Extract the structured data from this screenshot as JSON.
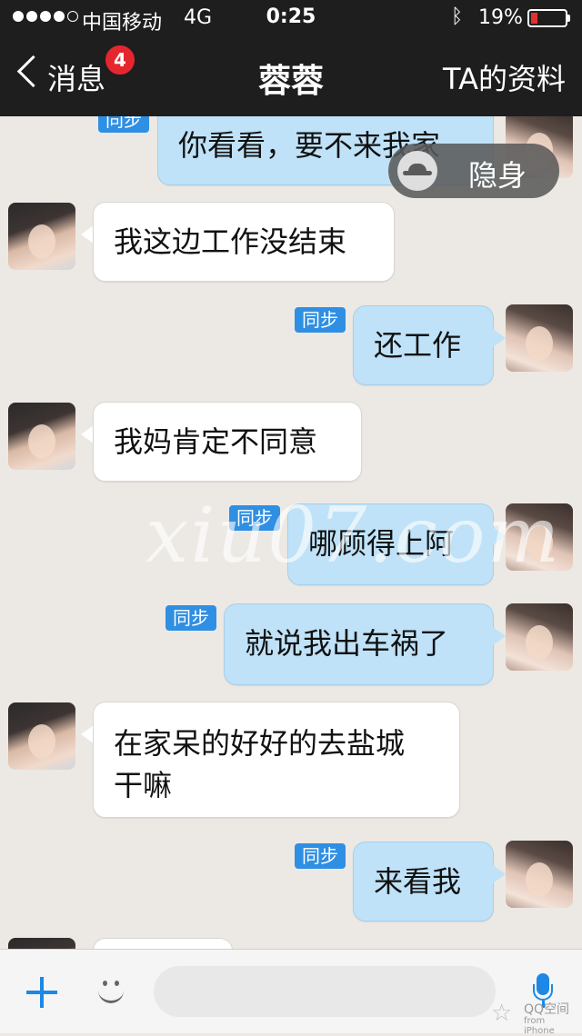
{
  "status_bar": {
    "carrier": "中国移动",
    "network": "4G",
    "time": "0:25",
    "battery_percent": "19%",
    "battery_level": 0.19,
    "battery_color": "#e53030",
    "signal_dots": 5,
    "signal_filled": 4,
    "bluetooth_icon": "bluetooth-icon"
  },
  "nav": {
    "back_label": "消息",
    "unread_badge": "4",
    "title": "蓉蓉",
    "right_label": "TA的资料"
  },
  "incognito_toast": {
    "icon": "incognito-hat-icon",
    "label": "隐身"
  },
  "sync_tag": "同步",
  "messages": [
    {
      "side": "out",
      "text": "你看看，要不来我家",
      "sync": true
    },
    {
      "side": "in",
      "text": "我这边工作没结束"
    },
    {
      "side": "out",
      "text": "还工作",
      "sync": true
    },
    {
      "side": "in",
      "text": "我妈肯定不同意"
    },
    {
      "side": "out",
      "text": "哪顾得上阿",
      "sync": true
    },
    {
      "side": "out",
      "text": "就说我出车祸了",
      "sync": true
    },
    {
      "side": "in",
      "text_line1": "在家呆的好好的去盐城",
      "text_line2": "干嘛"
    },
    {
      "side": "out",
      "text": "来看我",
      "sync": true
    },
    {
      "side": "in",
      "text": ""
    }
  ],
  "watermark": "xiu07.com",
  "input_bar": {
    "plus_icon": "plus-icon",
    "emoji_icon": "emoji-icon",
    "voice_icon": "microphone-icon"
  },
  "app_watermark": {
    "line1": "QQ空间",
    "line2": "from iPhone"
  },
  "colors": {
    "nav_bg": "#1e1e1e",
    "outgoing_bubble": "#bfe2f8",
    "incoming_bubble": "#ffffff",
    "accent": "#1d88e5",
    "sync_tag": "#2f8fe3",
    "badge": "#e6262e"
  }
}
